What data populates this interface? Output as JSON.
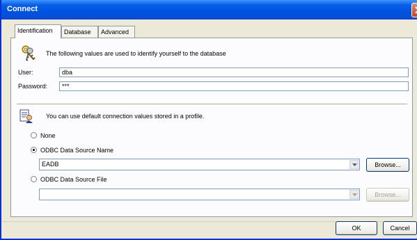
{
  "window": {
    "title": "Connect"
  },
  "tabs": [
    {
      "label": "Identification"
    },
    {
      "label": "Database"
    },
    {
      "label": "Advanced"
    }
  ],
  "identification": {
    "icon": "keys-icon",
    "description": "The following values are used to identify yourself to the database",
    "user_label": "User:",
    "user_value": "dba",
    "password_label": "Password:",
    "password_value": "***"
  },
  "profile": {
    "icon": "profile-document-icon",
    "description": "You can use default connection values stored in a profile.",
    "options": [
      {
        "label": "None",
        "selected": false
      },
      {
        "label": "ODBC Data Source Name",
        "selected": true
      },
      {
        "label": "ODBC Data Source File",
        "selected": false
      }
    ],
    "dsn_value": "EADB",
    "file_value": "",
    "browse_label": "Browse...",
    "browse_file_label": "Browse..."
  },
  "footer": {
    "ok_label": "OK",
    "cancel_label": "Cancel"
  }
}
